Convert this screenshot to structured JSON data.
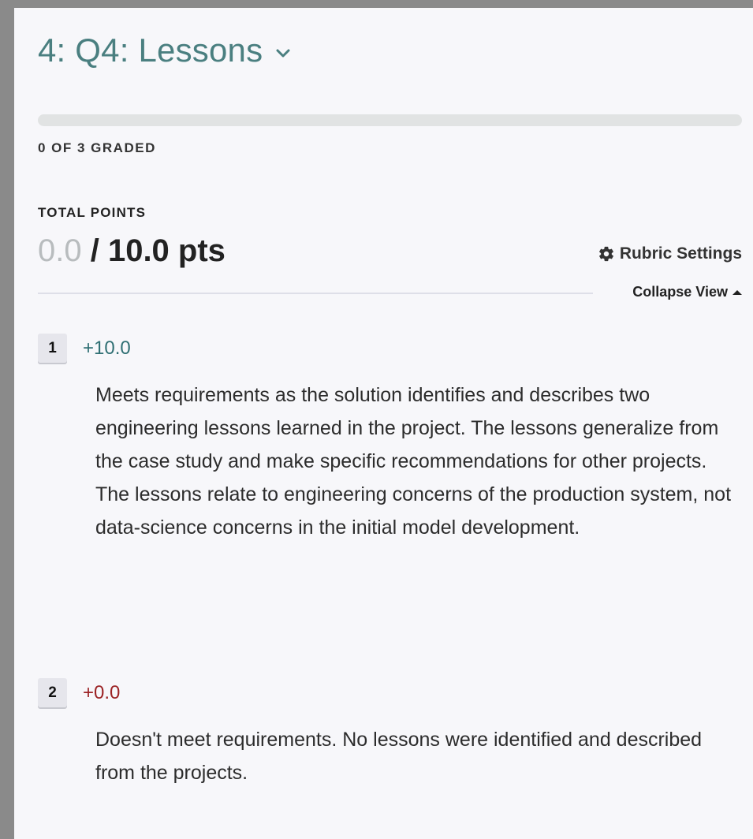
{
  "question": {
    "title": "4: Q4: Lessons"
  },
  "progress": {
    "fraction_complete": 0,
    "graded_text": "0 OF 3 GRADED"
  },
  "totals": {
    "label": "TOTAL POINTS",
    "earned": "0.0",
    "separator": " / ",
    "possible": "10.0 pts"
  },
  "rubric_settings": {
    "label": "Rubric Settings",
    "icon": "gear-icon"
  },
  "collapse": {
    "label": "Collapse View",
    "icon": "caret-up-icon"
  },
  "rubric_items": [
    {
      "key": "1",
      "points": "+10.0",
      "status_color": "#2f6f73",
      "description": "Meets requirements as the solution identifies and describes two engineering lessons learned in the project. The lessons generalize from the case study and make specific recommendations for other projects. The lessons relate to engineering concerns of the production system, not data-science concerns in the initial model development."
    },
    {
      "key": "2",
      "points": "+0.0",
      "status_color": "#9b2224",
      "description": "Doesn't meet requirements. No lessons were identified and described from the projects."
    }
  ],
  "colors": {
    "accent": "#4a7f80",
    "panel_bg": "#f7f7fa",
    "frame": "#8a8a8a"
  }
}
